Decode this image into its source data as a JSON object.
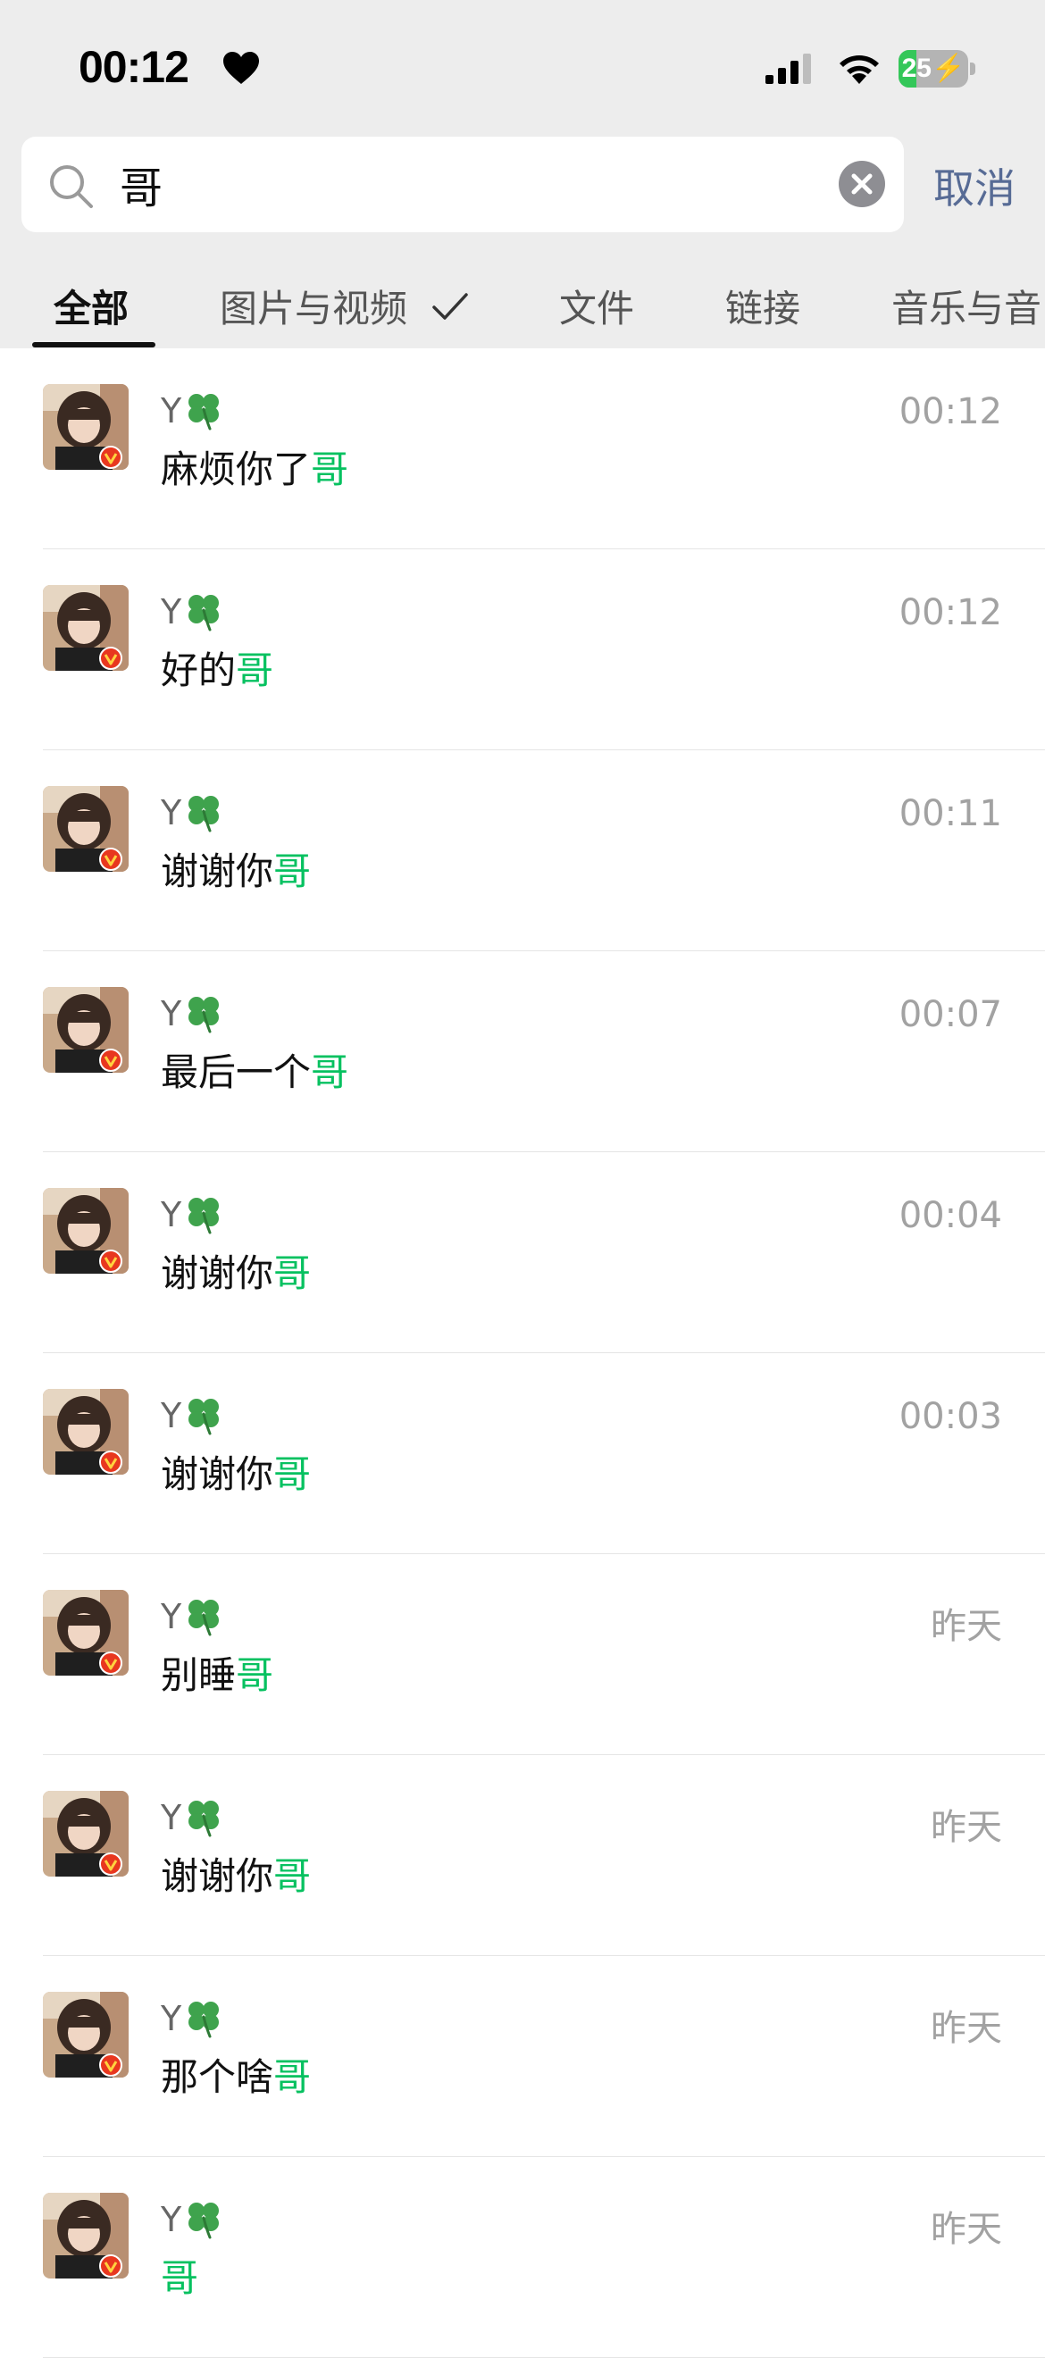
{
  "status_bar": {
    "time": "00:12",
    "battery": "25",
    "battery_level": 0.25
  },
  "search": {
    "query": "哥",
    "cancel_label": "取消"
  },
  "tabs": [
    {
      "label": "全部",
      "active": true
    },
    {
      "label": "图片与视频",
      "checked": true
    },
    {
      "label": "文件"
    },
    {
      "label": "链接"
    },
    {
      "label": "音乐与音"
    }
  ],
  "results": [
    {
      "sender": "Y",
      "pre": "麻烦你了",
      "match": "哥",
      "time": "00:12"
    },
    {
      "sender": "Y",
      "pre": "好的",
      "match": "哥",
      "time": "00:12"
    },
    {
      "sender": "Y",
      "pre": "谢谢你",
      "match": "哥",
      "time": "00:11"
    },
    {
      "sender": "Y",
      "pre": "最后一个",
      "match": "哥",
      "time": "00:07"
    },
    {
      "sender": "Y",
      "pre": "谢谢你",
      "match": "哥",
      "time": "00:04"
    },
    {
      "sender": "Y",
      "pre": "谢谢你",
      "match": "哥",
      "time": "00:03"
    },
    {
      "sender": "Y",
      "pre": "别睡",
      "match": "哥",
      "time": "昨天"
    },
    {
      "sender": "Y",
      "pre": "谢谢你",
      "match": "哥",
      "time": "昨天"
    },
    {
      "sender": "Y",
      "pre": "那个啥",
      "match": "哥",
      "time": "昨天"
    },
    {
      "sender": "Y",
      "pre": "",
      "match": "哥",
      "time": "昨天"
    }
  ],
  "colors": {
    "header_bg": "#ededed",
    "highlight": "#07c160",
    "cancel": "#576b95",
    "battery_green": "#34c759"
  }
}
